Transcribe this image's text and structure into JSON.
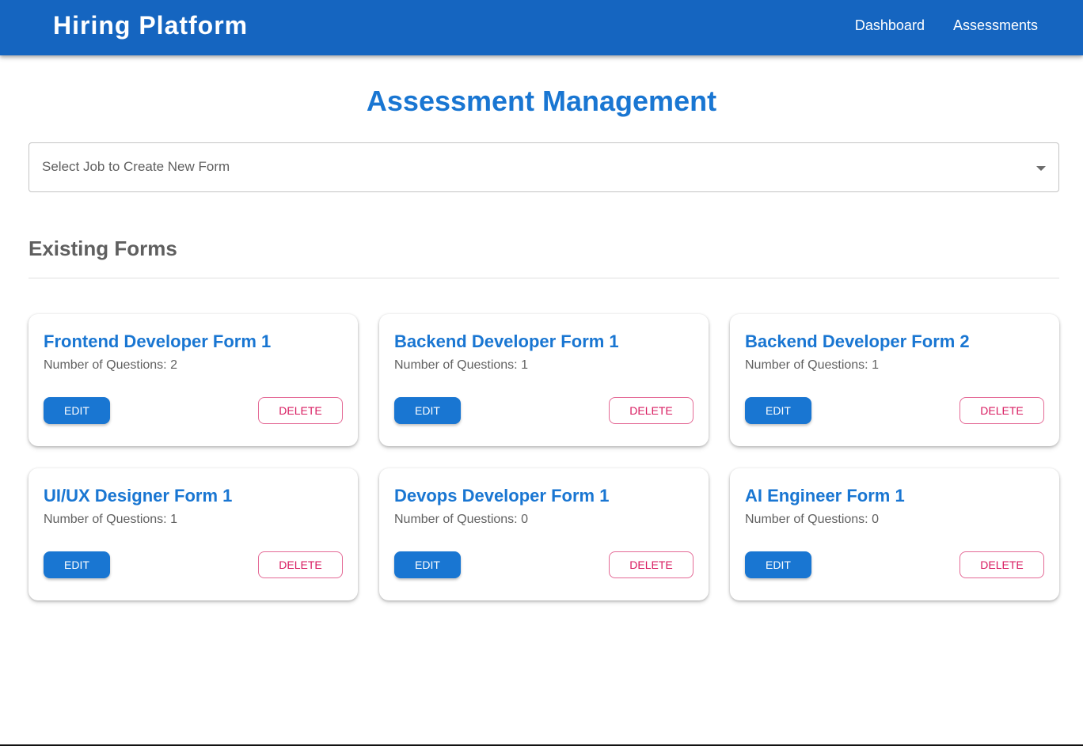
{
  "header": {
    "brand": "Hiring Platform",
    "nav": [
      "Dashboard",
      "Assessments"
    ]
  },
  "page": {
    "title": "Assessment Management",
    "select_placeholder": "Select Job to Create New Form",
    "section_title": "Existing Forms"
  },
  "forms": [
    {
      "title": "Frontend Developer Form 1",
      "questions": "Number of Questions: 2"
    },
    {
      "title": "Backend Developer Form 1",
      "questions": "Number of Questions: 1"
    },
    {
      "title": "Backend Developer Form 2",
      "questions": "Number of Questions: 1"
    },
    {
      "title": "UI/UX Designer Form 1",
      "questions": "Number of Questions: 1"
    },
    {
      "title": "Devops Developer Form 1",
      "questions": "Number of Questions: 0"
    },
    {
      "title": "AI Engineer Form 1",
      "questions": "Number of Questions: 0"
    }
  ],
  "buttons": {
    "edit": "EDIT",
    "delete": "DELETE"
  },
  "colors": {
    "appbar": "#1565c0",
    "primary": "#1976d2",
    "delete": "#d81b60"
  },
  "icons": {
    "select_arrow": "arrow-drop-down-icon"
  }
}
